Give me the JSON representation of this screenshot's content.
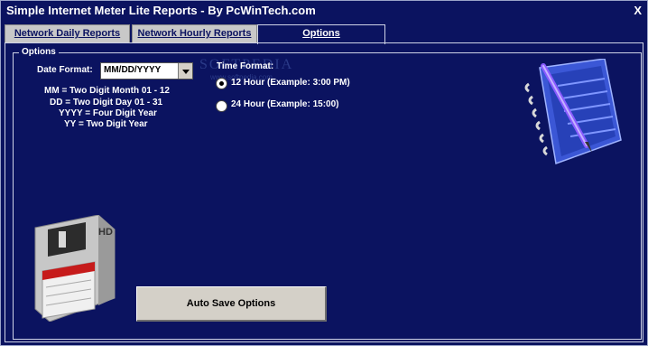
{
  "window": {
    "title": "Simple Internet Meter Lite Reports - By PcWinTech.com",
    "close": "X"
  },
  "tabs": [
    {
      "label": "Network Daily Reports"
    },
    {
      "label": "Network Hourly Reports"
    },
    {
      "label": "Options"
    }
  ],
  "options": {
    "group_label": "Options",
    "date_format_label": "Date Format:",
    "date_format_value": "MM/DD/YYYY",
    "help": [
      "MM = Two Digit Month 01 - 12",
      "DD = Two Digit Day 01 - 31",
      "YYYY = Four Digit Year",
      "YY = Two Digit Year"
    ],
    "time_format_label": "Time Format:",
    "time_12": "12 Hour (Example: 3:00 PM)",
    "time_24": "24 Hour (Example: 15:00)",
    "selected_time_format": "12 Hour",
    "auto_save_button": "Auto Save Options",
    "floppy_label": "HD"
  },
  "watermark": {
    "text": "SOFTPEDIA",
    "url": "www.softpedia.com"
  },
  "colors": {
    "background": "#0b1360",
    "button": "#d4d0c8",
    "tab_inactive": "#c8c8c8"
  }
}
